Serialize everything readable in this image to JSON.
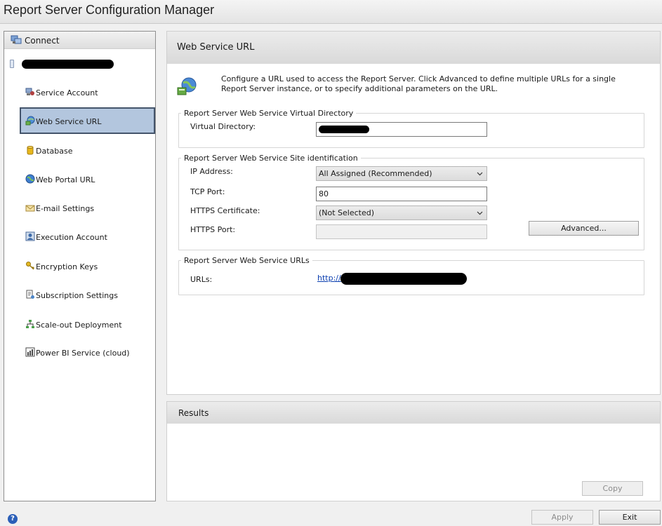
{
  "window": {
    "title": "Report Server Configuration Manager"
  },
  "sidebar": {
    "connect_label": "Connect",
    "items": [
      {
        "label": "Service Account",
        "icon": "service-account-icon"
      },
      {
        "label": "Web Service URL",
        "icon": "web-service-icon",
        "selected": true
      },
      {
        "label": "Database",
        "icon": "database-icon"
      },
      {
        "label": "Web Portal URL",
        "icon": "globe-icon"
      },
      {
        "label": "E-mail Settings",
        "icon": "email-icon"
      },
      {
        "label": "Execution Account",
        "icon": "user-icon"
      },
      {
        "label": "Encryption Keys",
        "icon": "keys-icon"
      },
      {
        "label": "Subscription Settings",
        "icon": "subscription-icon"
      },
      {
        "label": "Scale-out Deployment",
        "icon": "network-icon"
      },
      {
        "label": "Power BI Service (cloud)",
        "icon": "power-bi-icon"
      }
    ]
  },
  "main": {
    "title": "Web Service URL",
    "intro": "Configure a URL used to access the Report Server.  Click Advanced to define multiple URLs for a single Report Server instance, or to specify additional parameters on the URL.",
    "virtual_directory": {
      "legend": "Report Server Web Service Virtual Directory",
      "label": "Virtual Directory:"
    },
    "site_identification": {
      "legend": "Report Server Web Service Site identification",
      "ip_label": "IP Address:",
      "ip_value": "All Assigned (Recommended)",
      "tcp_label": "TCP Port:",
      "tcp_value": "80",
      "https_cert_label": "HTTPS Certificate:",
      "https_cert_value": "(Not Selected)",
      "https_port_label": "HTTPS Port:",
      "https_port_value": "",
      "advanced_label": "Advanced..."
    },
    "urls": {
      "legend": "Report Server Web Service URLs",
      "label": "URLs:",
      "link_prefix": "http://"
    }
  },
  "results": {
    "title": "Results",
    "copy_label": "Copy"
  },
  "footer": {
    "apply_label": "Apply",
    "exit_label": "Exit"
  }
}
